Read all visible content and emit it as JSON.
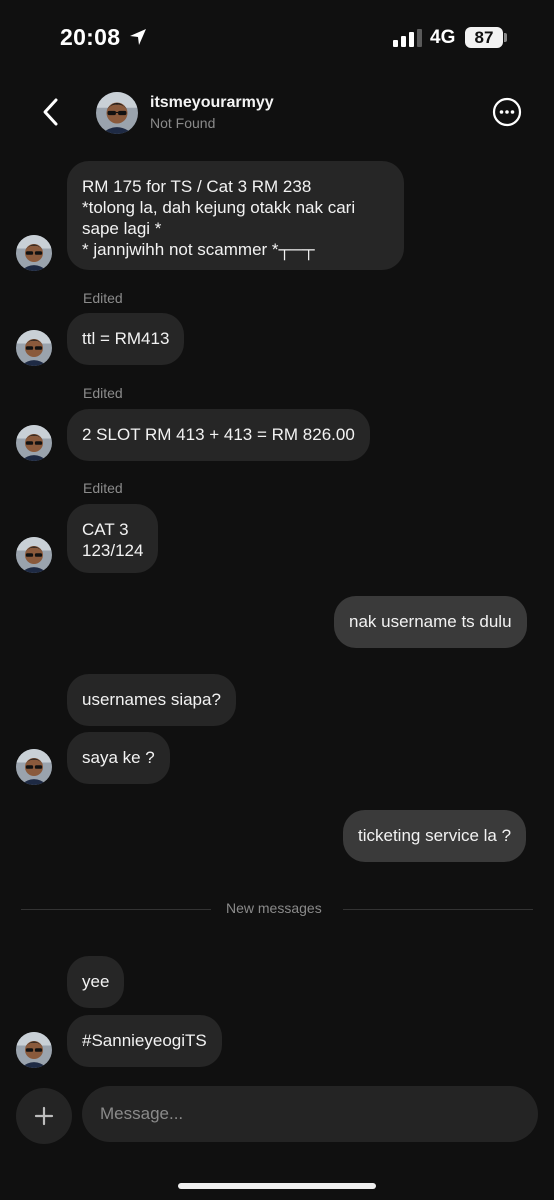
{
  "status_bar": {
    "time": "20:08",
    "network": "4G",
    "battery": "87"
  },
  "header": {
    "name": "itsmeyourarmyy",
    "status": "Not Found"
  },
  "messages": {
    "m1": "RM 175 for TS / Cat 3 RM 238\n*tolong la, dah kejung otakk nak cari sape lagi *\n* jannjwihh not scammer *┬─┬",
    "m2": "ttl = RM413",
    "m3": "2 SLOT RM 413 + 413 = RM 826.00",
    "m4": "CAT 3\n123/124",
    "m5": "nak username ts dulu",
    "m6": "usernames siapa?",
    "m7": "saya ke ?",
    "m8": "ticketing service la ?",
    "m9": "yee",
    "m10": "#SannieyeogiTS"
  },
  "edited_label": "Edited",
  "divider": {
    "label": "New messages"
  },
  "composer": {
    "placeholder": "Message..."
  },
  "icons": [
    "location-arrow-icon",
    "signal-bars-icon",
    "back-chevron-icon",
    "more-icon",
    "plus-icon"
  ]
}
